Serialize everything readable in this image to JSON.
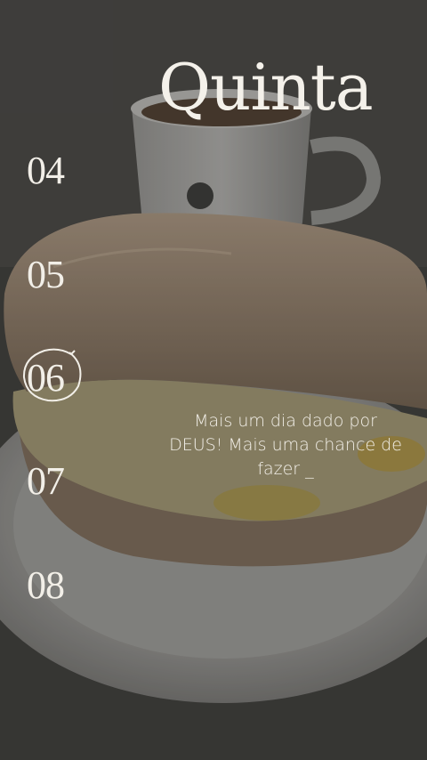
{
  "title": "Quinta",
  "days": [
    "04",
    "05",
    "06",
    "07",
    "08"
  ],
  "selected_day": "06",
  "message": "Mais um dia dado por DEUS! Mais uma chance de fazer _",
  "colors": {
    "text": "#f3f0e9",
    "overlay": "#2f2f2d"
  }
}
